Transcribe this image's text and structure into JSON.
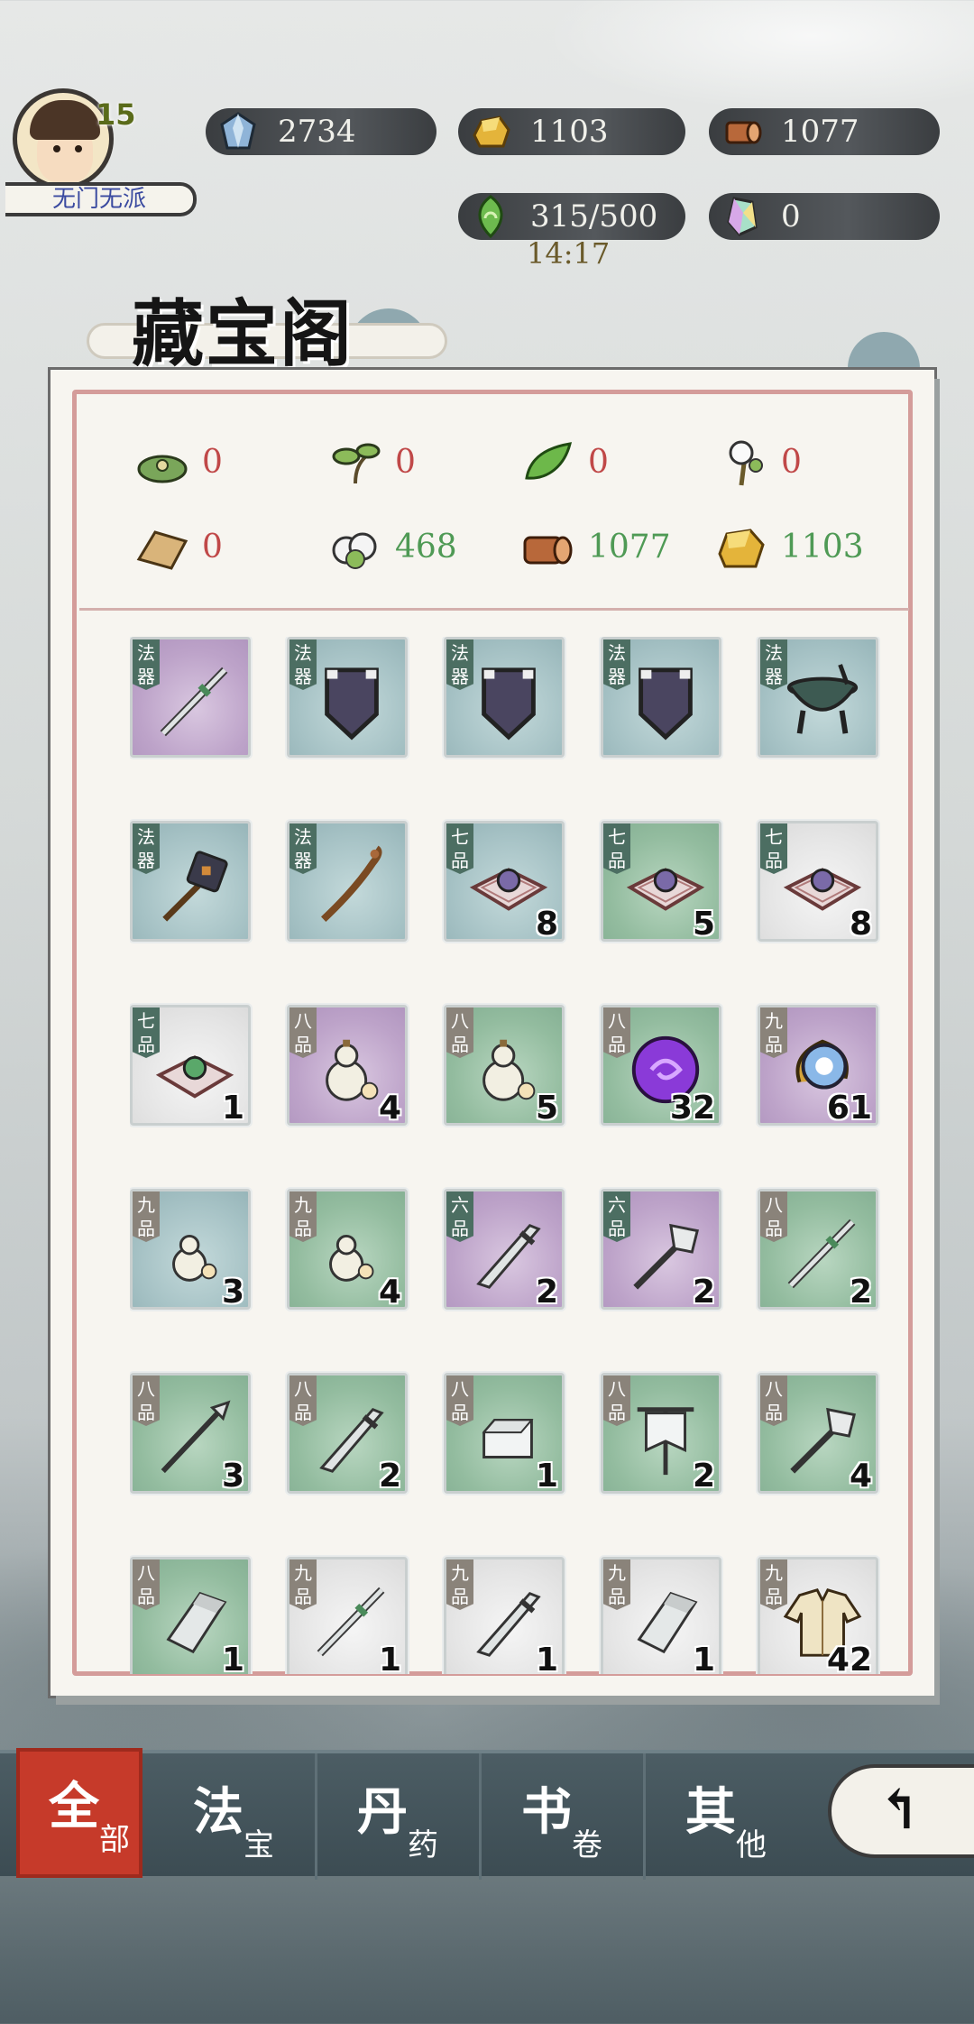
{
  "player": {
    "level": "15",
    "sect": "无门无派"
  },
  "resources": {
    "spirit_stone": "2734",
    "gold": "1103",
    "wood": "1077",
    "energy": "315/500",
    "energy_timer": "14:17",
    "crystal": "0"
  },
  "title": "藏宝阁",
  "materials": [
    {
      "icon": "herb-nest-icon",
      "count": "0"
    },
    {
      "icon": "sprout-icon",
      "count": "0"
    },
    {
      "icon": "green-leaf-icon",
      "count": "0"
    },
    {
      "icon": "white-flower-icon",
      "count": "0"
    },
    {
      "icon": "paper-icon",
      "count": "0"
    },
    {
      "icon": "cotton-icon",
      "count": "468"
    },
    {
      "icon": "log-icon",
      "count": "1077"
    },
    {
      "icon": "gold-ore-icon",
      "count": "1103"
    }
  ],
  "items": [
    {
      "tag": "法器",
      "bg": "purple",
      "icon": "sword-icon",
      "qty": ""
    },
    {
      "tag": "法器",
      "bg": "blue",
      "icon": "shield-icon",
      "qty": ""
    },
    {
      "tag": "法器",
      "bg": "blue",
      "icon": "shield-icon",
      "qty": ""
    },
    {
      "tag": "法器",
      "bg": "blue",
      "icon": "shield-icon",
      "qty": ""
    },
    {
      "tag": "法器",
      "bg": "blue",
      "icon": "cauldron-icon",
      "qty": ""
    },
    {
      "tag": "法器",
      "bg": "blue",
      "icon": "mace-icon",
      "qty": ""
    },
    {
      "tag": "法器",
      "bg": "blue",
      "icon": "staff-icon",
      "qty": ""
    },
    {
      "tag": "七品",
      "bg": "blue",
      "icon": "pearl-cushion-icon",
      "qty": "8"
    },
    {
      "tag": "七品",
      "bg": "green",
      "icon": "pearl-cushion-icon",
      "qty": "5"
    },
    {
      "tag": "七品",
      "bg": "white",
      "icon": "pearl-cushion-icon",
      "qty": "8"
    },
    {
      "tag": "七品",
      "bg": "white",
      "icon": "green-pearl-cushion-icon",
      "qty": "1"
    },
    {
      "tag": "八品",
      "bg": "purple",
      "icon": "gourd-icon",
      "qty": "4"
    },
    {
      "tag": "八品",
      "bg": "green",
      "icon": "gourd-icon",
      "qty": "5"
    },
    {
      "tag": "八品",
      "bg": "green",
      "icon": "purple-orb-icon",
      "qty": "32"
    },
    {
      "tag": "九品",
      "bg": "purple",
      "icon": "blue-orb-icon",
      "qty": "61"
    },
    {
      "tag": "九品",
      "bg": "blue",
      "icon": "small-gourd-icon",
      "qty": "3"
    },
    {
      "tag": "九品",
      "bg": "green",
      "icon": "small-gourd-icon",
      "qty": "4"
    },
    {
      "tag": "六品",
      "bg": "purple",
      "icon": "broadsword-icon",
      "qty": "2"
    },
    {
      "tag": "六品",
      "bg": "purple",
      "icon": "axe-icon",
      "qty": "2"
    },
    {
      "tag": "八品",
      "bg": "green",
      "icon": "sword-icon",
      "qty": "2"
    },
    {
      "tag": "八品",
      "bg": "green",
      "icon": "spear-icon",
      "qty": "3"
    },
    {
      "tag": "八品",
      "bg": "green",
      "icon": "broadsword-icon",
      "qty": "2"
    },
    {
      "tag": "八品",
      "bg": "green",
      "icon": "cloth-block-icon",
      "qty": "1"
    },
    {
      "tag": "八品",
      "bg": "green",
      "icon": "banner-icon",
      "qty": "2"
    },
    {
      "tag": "八品",
      "bg": "green",
      "icon": "axe-icon",
      "qty": "4"
    },
    {
      "tag": "八品",
      "bg": "green",
      "icon": "whetstone-icon",
      "qty": "1"
    },
    {
      "tag": "九品",
      "bg": "white",
      "icon": "sword-icon",
      "qty": "1"
    },
    {
      "tag": "九品",
      "bg": "white",
      "icon": "broadsword-icon",
      "qty": "1"
    },
    {
      "tag": "九品",
      "bg": "white",
      "icon": "whetstone-icon",
      "qty": "1"
    },
    {
      "tag": "九品",
      "bg": "white",
      "icon": "robe-icon",
      "qty": "42"
    }
  ],
  "tabs": [
    {
      "main": "全",
      "sub": "部"
    },
    {
      "main": "法",
      "sub": "宝"
    },
    {
      "main": "丹",
      "sub": "药"
    },
    {
      "main": "书",
      "sub": "卷"
    },
    {
      "main": "其",
      "sub": "他"
    }
  ],
  "colors": {
    "active_tab": "#c63a2a",
    "zero_count": "#c04848",
    "positive_count": "#4f9a55"
  }
}
